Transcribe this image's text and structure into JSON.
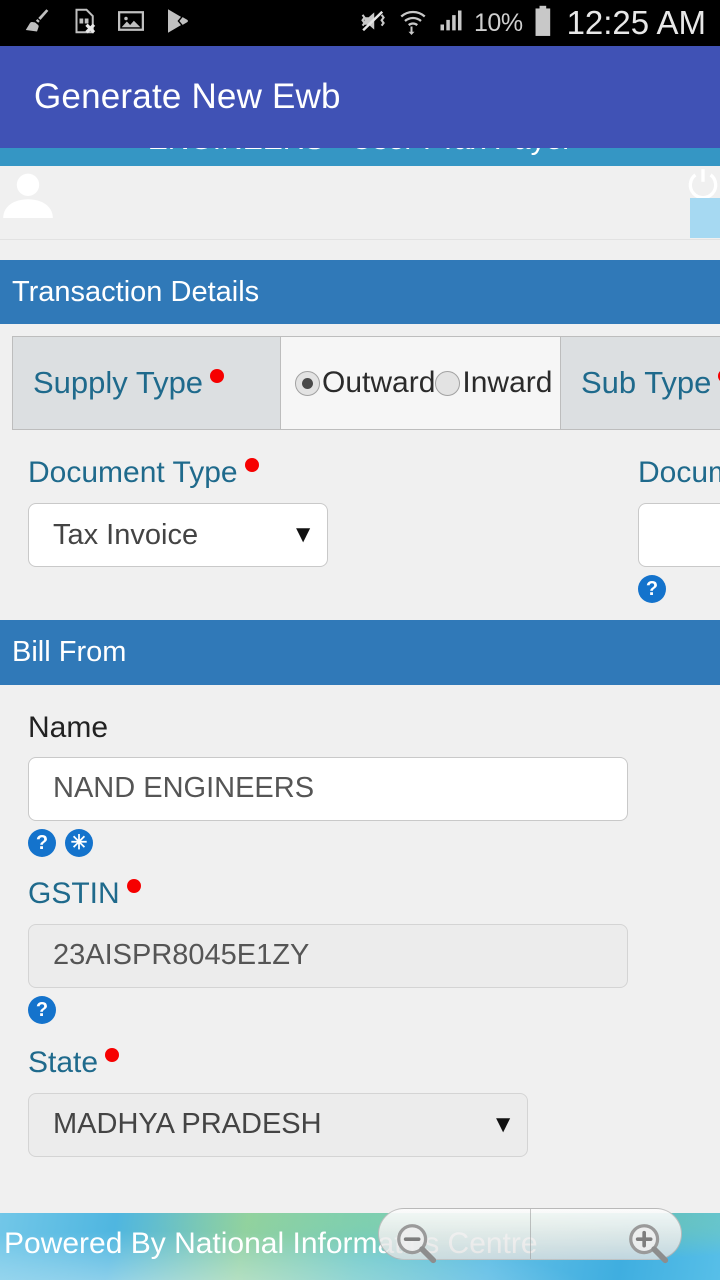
{
  "statusbar": {
    "icons_left": [
      "broom-cleaner-icon",
      "sim-card-error-icon",
      "gallery-image-icon",
      "play-store-icon"
    ],
    "icons_right": [
      "mute-vibrate-icon",
      "wifi-data-icon",
      "cellular-signal-icon"
    ],
    "battery_percent": "10%",
    "clock": "12:25 AM"
  },
  "appbar": {
    "title": "Generate New Ewb"
  },
  "site": {
    "banner_text": "ENGINEERS - User : Tax Payer",
    "user_icon": "user-silhouette-icon",
    "power_icon": "power-logout-icon"
  },
  "transaction": {
    "header": "Transaction Details",
    "supply_type": {
      "label": "Supply Type",
      "required": true,
      "options": [
        {
          "label": "Outward",
          "selected": true
        },
        {
          "label": "Inward",
          "selected": false
        }
      ]
    },
    "sub_type": {
      "label": "Sub Type",
      "required": true
    },
    "document_type": {
      "label": "Document Type",
      "required": true,
      "value": "Tax Invoice"
    },
    "document_no": {
      "label": "Docum",
      "value": "",
      "placeholder": "",
      "help_icon": "help-question-icon"
    }
  },
  "bill_from": {
    "header": "Bill From",
    "name": {
      "label": "Name",
      "value": "NAND ENGINEERS",
      "help_icon": "help-question-icon",
      "clear_icon": "clear-asterisk-icon"
    },
    "gstin": {
      "label": "GSTIN",
      "required": true,
      "value": "23AISPR8045E1ZY",
      "help_icon": "help-question-icon"
    },
    "state": {
      "label": "State",
      "required": true,
      "value": "MADHYA PRADESH"
    }
  },
  "footer": {
    "text": "Powered By National Informatics Centre"
  },
  "zoom_controls": {
    "zoom_out_icon": "zoom-out-magnifier-icon",
    "zoom_in_icon": "zoom-in-magnifier-icon"
  },
  "colors": {
    "appbar": "#4052b5",
    "section_header": "#3079b8",
    "banner": "#3596c4",
    "label_blue": "#1f6a8c",
    "required_red": "#f60000",
    "icon_blue": "#1473cc"
  }
}
